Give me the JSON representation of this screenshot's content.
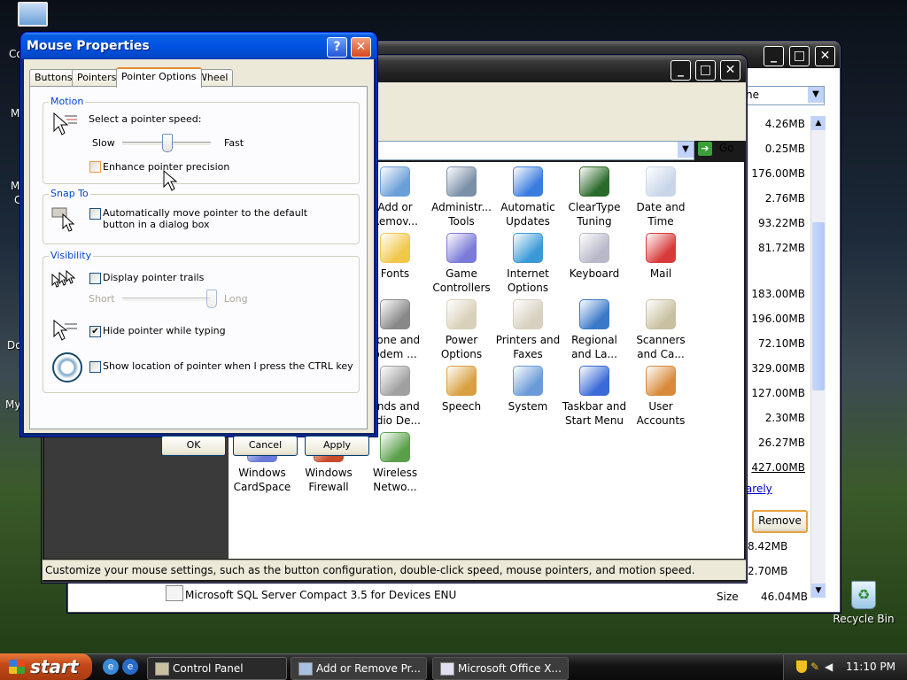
{
  "desktop": {
    "icons_left": [
      "Co",
      "M",
      "M",
      "C",
      "Do",
      "My"
    ],
    "recycle_bin": "Recycle Bin"
  },
  "add_remove": {
    "search_value": "ne",
    "sizes": [
      "4.26MB",
      "0.25MB",
      "176.00MB",
      "2.76MB",
      "93.22MB",
      "81.72MB",
      "183.00MB",
      "196.00MB",
      "72.10MB",
      "329.00MB",
      "127.00MB",
      "2.30MB",
      "26.27MB",
      "427.00MB"
    ],
    "used_label": "rarely",
    "remove_button": "Remove",
    "sizes_after": [
      "8.42MB",
      "2.70MB"
    ],
    "bottom_item": "Microsoft SQL Server Compact 3.5 for Devices ENU",
    "bottom_size_label": "Size",
    "bottom_size": "46.04MB"
  },
  "control_panel": {
    "go_label": "Go",
    "items": [
      {
        "label": "Add or\nRemov...",
        "icon": "add-remove-programs-icon",
        "color": "#6a9fd8"
      },
      {
        "label": "Administr...\nTools",
        "icon": "administrative-tools-icon",
        "color": "#7a8fa8"
      },
      {
        "label": "Automatic\nUpdates",
        "icon": "automatic-updates-icon",
        "color": "#3a7de0"
      },
      {
        "label": "ClearType\nTuning",
        "icon": "cleartype-icon",
        "color": "#2a6a2a"
      },
      {
        "label": "Date and\nTime",
        "icon": "date-time-icon",
        "color": "#c9d6ea"
      },
      {
        "label": "Fonts",
        "icon": "fonts-folder-icon",
        "color": "#f0c84a"
      },
      {
        "label": "Game\nControllers",
        "icon": "game-controllers-icon",
        "color": "#7a7ad8"
      },
      {
        "label": "Internet\nOptions",
        "icon": "internet-options-icon",
        "color": "#3a9ad8"
      },
      {
        "label": "Keyboard",
        "icon": "keyboard-icon",
        "color": "#b8b8c8"
      },
      {
        "label": "Mail",
        "icon": "mail-icon",
        "color": "#d83a3a"
      },
      {
        "label": "hone and\nodem ...",
        "icon": "phone-modem-icon",
        "color": "#888888"
      },
      {
        "label": "Power\nOptions",
        "icon": "power-options-icon",
        "color": "#d8d0b8"
      },
      {
        "label": "Printers and\nFaxes",
        "icon": "printers-faxes-icon",
        "color": "#d8d0c0"
      },
      {
        "label": "Regional\nand La...",
        "icon": "regional-language-icon",
        "color": "#3a78c8"
      },
      {
        "label": "Scanners\nand Ca...",
        "icon": "scanners-cameras-icon",
        "color": "#c8c0a0"
      },
      {
        "label": "unds and\nudio De...",
        "icon": "sounds-audio-icon",
        "color": "#a0a0a0"
      },
      {
        "label": "Speech",
        "icon": "speech-icon",
        "color": "#d8a040"
      },
      {
        "label": "System",
        "icon": "system-icon",
        "color": "#6a9ad8"
      },
      {
        "label": "Taskbar and\nStart Menu",
        "icon": "taskbar-startmenu-icon",
        "color": "#3a6ad8"
      },
      {
        "label": "User\nAccounts",
        "icon": "user-accounts-icon",
        "color": "#d88a3a"
      },
      {
        "label": "Windows\nCardSpace",
        "icon": "cardspace-icon",
        "color": "#6a7ad8"
      },
      {
        "label": "Windows\nFirewall",
        "icon": "firewall-icon",
        "color": "#c84a2a"
      },
      {
        "label": "Wireless\nNetwo...",
        "icon": "wireless-network-icon",
        "color": "#5aa04a"
      }
    ],
    "status_bar": "Customize your mouse settings, such as the button configuration, double-click speed, mouse pointers, and motion speed."
  },
  "dialog": {
    "title": "Mouse Properties",
    "help_button": "?",
    "close_button": "✕",
    "tabs": [
      "Buttons",
      "Pointers",
      "Pointer Options",
      "Wheel"
    ],
    "active_tab": "Pointer Options",
    "motion": {
      "group_label": "Motion",
      "prompt": "Select a pointer speed:",
      "slow": "Slow",
      "fast": "Fast",
      "speed_fraction": 0.5,
      "enhance_label": "Enhance pointer precision",
      "enhance_checked": false
    },
    "snap": {
      "group_label": "Snap To",
      "label": "Automatically move pointer to the default button in a dialog box",
      "checked": false
    },
    "visibility": {
      "group_label": "Visibility",
      "trails_label": "Display pointer trails",
      "trails_checked": false,
      "short": "Short",
      "long": "Long",
      "trails_fraction": 1.0,
      "hide_label": "Hide pointer while typing",
      "hide_checked": true,
      "ctrl_label": "Show location of pointer when I press the CTRL key",
      "ctrl_checked": false
    },
    "ok": "OK",
    "cancel": "Cancel",
    "apply": "Apply"
  },
  "taskbar": {
    "start": "start",
    "buttons": [
      "Control Panel",
      "Add or Remove Pr...",
      "Microsoft Office X..."
    ],
    "clock": "11:10 PM"
  }
}
